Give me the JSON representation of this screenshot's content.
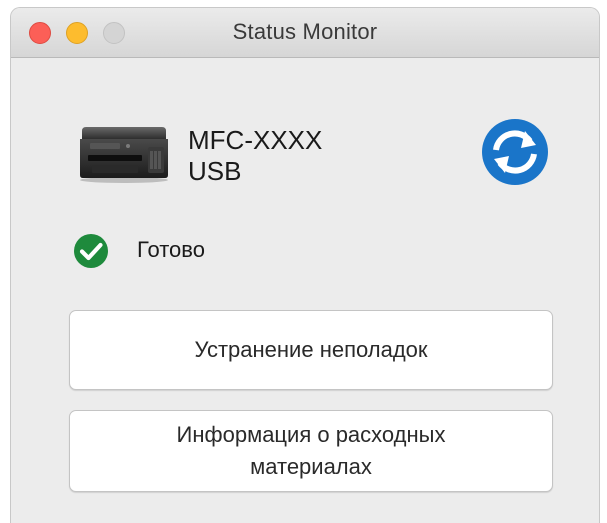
{
  "window": {
    "title": "Status Monitor"
  },
  "device": {
    "name": "MFC-XXXX",
    "port": "USB",
    "icon": "printer-icon"
  },
  "status": {
    "icon": "check-icon",
    "text": "Готово",
    "color": "#1e8a3c"
  },
  "buttons": {
    "troubleshoot_label": "Устранение неполадок",
    "supplies_label": "Информация о расходных материалах"
  },
  "refresh": {
    "icon": "refresh-icon",
    "color": "#1a75c9"
  },
  "traffic_lights": {
    "close_color": "#fc5f57",
    "minimize_color": "#fdbc2e",
    "zoom_color": "#d4d4d4"
  }
}
